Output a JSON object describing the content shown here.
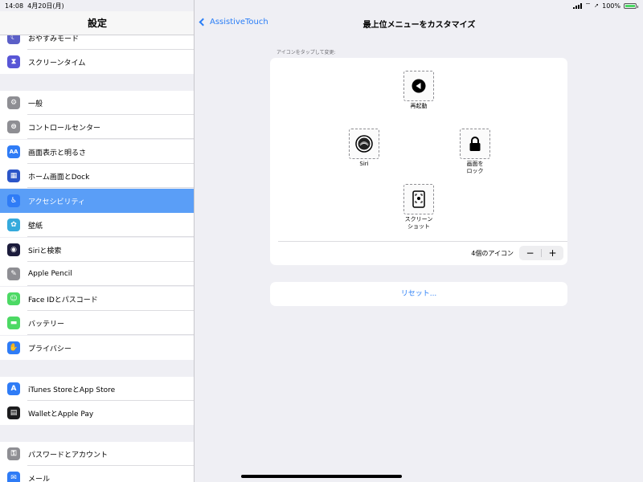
{
  "status": {
    "time": "14:08",
    "date": "4月20日(月)",
    "battery": "100%"
  },
  "sidebar": {
    "title": "設定",
    "items": [
      {
        "label": "おやすみモード",
        "color": "#5b5fc7",
        "icon": "moon-icon",
        "glyph": "☾"
      },
      {
        "label": "スクリーンタイム",
        "color": "#5856d6",
        "icon": "hourglass-icon",
        "glyph": "⧗"
      },
      {
        "label": "一般",
        "color": "#8e8e93",
        "icon": "gear-icon",
        "glyph": "⚙"
      },
      {
        "label": "コントロールセンター",
        "color": "#8e8e93",
        "icon": "switches-icon",
        "glyph": "⊜"
      },
      {
        "label": "画面表示と明るさ",
        "color": "#2f7cf6",
        "icon": "text-size-icon",
        "glyph": "AA"
      },
      {
        "label": "ホーム画面とDock",
        "color": "#2b55c8",
        "icon": "home-grid-icon",
        "glyph": "▦"
      },
      {
        "label": "アクセシビリティ",
        "color": "#2f7cf6",
        "icon": "accessibility-icon",
        "glyph": "♿"
      },
      {
        "label": "壁紙",
        "color": "#35aadc",
        "icon": "wallpaper-icon",
        "glyph": "✿"
      },
      {
        "label": "Siriと検索",
        "color": "#1c1c3c",
        "icon": "siri-icon",
        "glyph": "◉"
      },
      {
        "label": "Apple Pencil",
        "color": "#8e8e93",
        "icon": "pencil-icon",
        "glyph": "✎"
      },
      {
        "label": "Face IDとパスコード",
        "color": "#4cd964",
        "icon": "face-id-icon",
        "glyph": "☺"
      },
      {
        "label": "バッテリー",
        "color": "#4cd964",
        "icon": "battery-icon",
        "glyph": "▬"
      },
      {
        "label": "プライバシー",
        "color": "#2f7cf6",
        "icon": "hand-icon",
        "glyph": "✋"
      },
      {
        "label": "iTunes StoreとApp Store",
        "color": "#2f7cf6",
        "icon": "app-store-icon",
        "glyph": "A"
      },
      {
        "label": "WalletとApple Pay",
        "color": "#1c1c1e",
        "icon": "wallet-icon",
        "glyph": "▤"
      },
      {
        "label": "パスワードとアカウント",
        "color": "#8e8e93",
        "icon": "key-icon",
        "glyph": "⚿"
      },
      {
        "label": "メール",
        "color": "#2f7cf6",
        "icon": "mail-icon",
        "glyph": "✉"
      }
    ]
  },
  "nav": {
    "back_label": "AssistiveTouch",
    "title": "最上位メニューをカスタマイズ"
  },
  "main": {
    "hint": "アイコンをタップして変更:",
    "slots": [
      {
        "label": "再起動",
        "icon": "restart-icon"
      },
      {
        "label": "Siri",
        "icon": "siri-icon"
      },
      {
        "label": "画面を\nロック",
        "icon": "lock-icon"
      },
      {
        "label": "スクリーン\nショット",
        "icon": "screenshot-icon"
      }
    ],
    "count_label": "4個のアイコン",
    "minus": "−",
    "plus": "+",
    "reset_label": "リセット..."
  },
  "colors": {
    "accent": "#2a7ef6",
    "selected_row": "#5a9ef7",
    "background": "#efeff4"
  }
}
